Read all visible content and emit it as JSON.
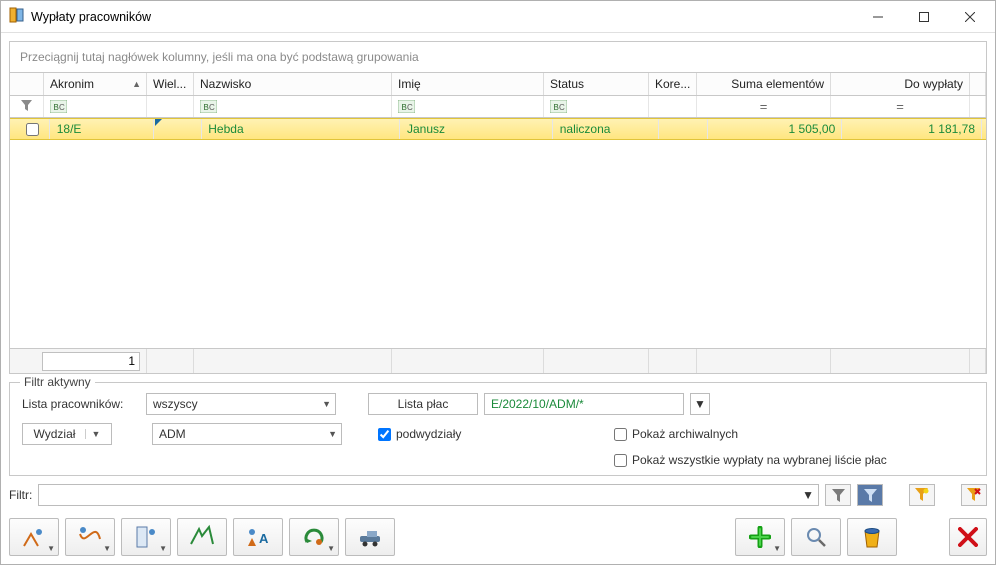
{
  "titlebar": {
    "title": "Wypłaty pracowników"
  },
  "grid": {
    "group_hint": "Przeciągnij tutaj nagłówek kolumny, jeśli ma ona być podstawą grupowania",
    "columns": {
      "akronim": "Akronim",
      "wiel": "Wiel...",
      "nazwisko": "Nazwisko",
      "imie": "Imię",
      "status": "Status",
      "kore": "Kore...",
      "suma": "Suma elementów",
      "dowyplaty": "Do wypłaty"
    },
    "rows": [
      {
        "akronim": "18/E",
        "nazwisko": "Hebda",
        "imie": "Janusz",
        "status": "naliczona",
        "suma": "1 505,00",
        "dowyplaty": "1 181,78"
      }
    ],
    "sum_count": "1"
  },
  "filter_panel": {
    "legend": "Filtr aktywny",
    "lista_pracownikow_label": "Lista pracowników:",
    "lista_pracownikow_value": "wszyscy",
    "lista_plac_label": "Lista płac",
    "lista_plac_value": "E/2022/10/ADM/*",
    "wydzial_label": "Wydział",
    "wydzial_value": "ADM",
    "podwydzialy_label": "podwydziały",
    "archiwalne_label": "Pokaż archiwalnych",
    "wszystkie_label": "Pokaż wszystkie wypłaty na wybranej liście płac"
  },
  "filter_row": {
    "label": "Filtr:"
  },
  "icons": {
    "funnel": "▾",
    "eq": "="
  }
}
